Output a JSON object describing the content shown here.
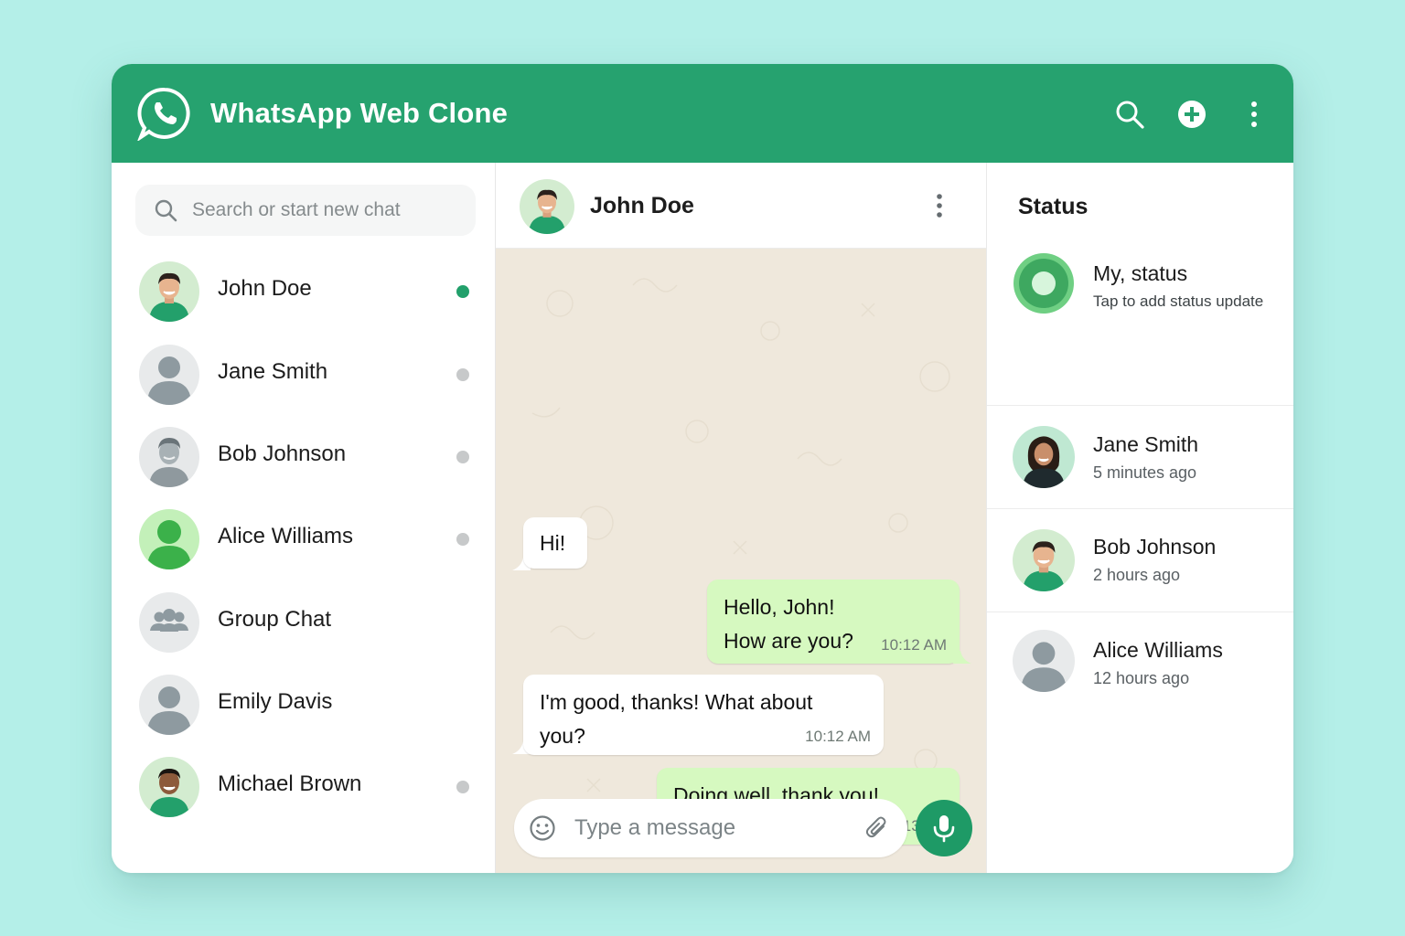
{
  "app": {
    "title": "WhatsApp Web Clone",
    "brand_color": "#26a26f",
    "icons": [
      "whatsapp-logo",
      "search-icon",
      "new-chat-icon",
      "more-vertical-icon"
    ]
  },
  "sidebar": {
    "search_placeholder": "Search or start new chat",
    "chats": [
      {
        "name": "John Doe",
        "avatar": "man-photo",
        "online": true
      },
      {
        "name": "Jane Smith",
        "avatar": "default-person",
        "online": false
      },
      {
        "name": "Bob Johnson",
        "avatar": "man-grey-photo",
        "online": false
      },
      {
        "name": "Alice Williams",
        "avatar": "green-person",
        "online": false
      },
      {
        "name": "Group Chat",
        "avatar": "group-icon",
        "online": null
      },
      {
        "name": "Emily Davis",
        "avatar": "default-person",
        "online": null
      },
      {
        "name": "Michael Brown",
        "avatar": "man-dark-photo",
        "online": false
      }
    ]
  },
  "conversation": {
    "contact_name": "John Doe",
    "messages": [
      {
        "direction": "in",
        "text": "Hi!",
        "time": ""
      },
      {
        "direction": "out",
        "lines": [
          "Hello, John!",
          "How are you?"
        ],
        "time": "10:12 AM"
      },
      {
        "direction": "in",
        "lines": [
          "I'm good, thanks! What about",
          "you?"
        ],
        "time": "10:12 AM"
      },
      {
        "direction": "out",
        "lines": [
          "Doing well, thank you!"
        ],
        "time": "10:13 AM"
      }
    ],
    "composer_placeholder": "Type a message",
    "background_color": "#efe8dc",
    "outgoing_bubble_color": "#d6f9c0"
  },
  "status": {
    "title": "Status",
    "my_status": {
      "name": "My, status",
      "subtitle": "Tap to add status update"
    },
    "updates": [
      {
        "name": "Jane Smith",
        "time": "5 minutes ago",
        "avatar": "woman-photo"
      },
      {
        "name": "Bob Johnson",
        "time": "2 hours ago",
        "avatar": "man-photo"
      },
      {
        "name": "Alice Williams",
        "time": "12 hours ago",
        "avatar": "default-person"
      }
    ]
  }
}
